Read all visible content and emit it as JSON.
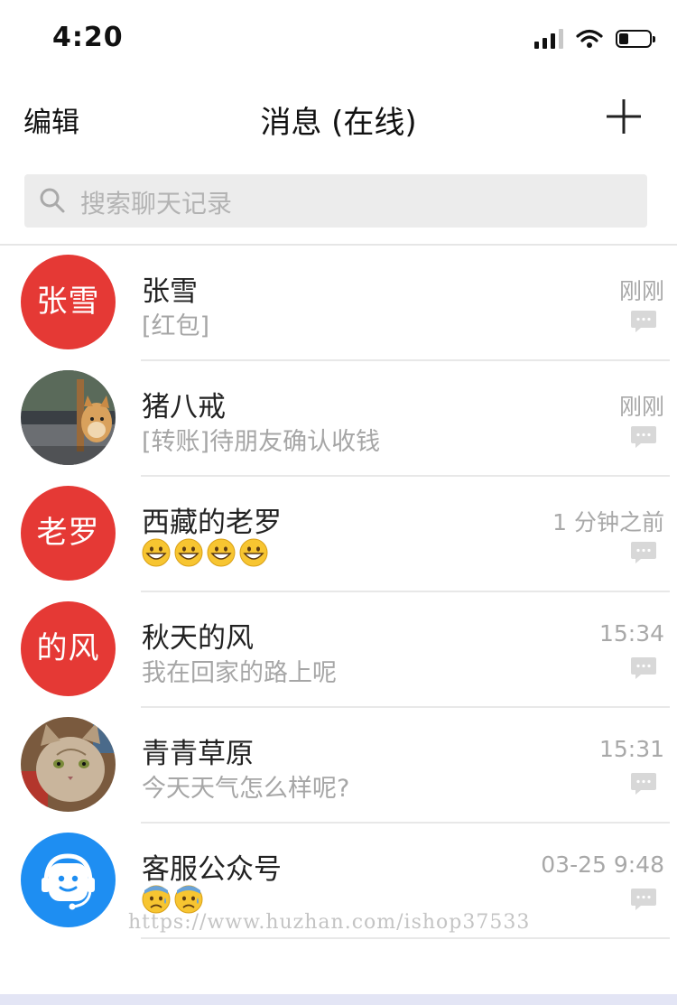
{
  "status_bar": {
    "time": "4:20"
  },
  "nav": {
    "edit_label": "编辑",
    "title": "消息 (在线)"
  },
  "search": {
    "placeholder": "搜索聊天记录"
  },
  "conversations": [
    {
      "name": "张雪",
      "message": "[红包]",
      "time": "刚刚",
      "avatar_text": "张雪",
      "avatar_type": "text-red"
    },
    {
      "name": "猪八戒",
      "message": "[转账]待朋友确认收钱",
      "time": "刚刚",
      "avatar_type": "photo-dog"
    },
    {
      "name": "西藏的老罗",
      "message": "",
      "emoji_count": 4,
      "emoji": "grinning-face",
      "time": "1 分钟之前",
      "avatar_text": "老罗",
      "avatar_type": "text-red"
    },
    {
      "name": "秋天的风",
      "message": "我在回家的路上呢",
      "time": "15:34",
      "avatar_text": "的风",
      "avatar_type": "text-red"
    },
    {
      "name": "青青草原",
      "message": "今天天气怎么样呢?",
      "time": "15:31",
      "avatar_type": "photo-cat"
    },
    {
      "name": "客服公众号",
      "message": "",
      "emoji_count": 2,
      "emoji": "anxious-sweat-face",
      "time": "03-25 9:48",
      "avatar_type": "service-blue"
    }
  ],
  "watermark": "https://www.huzhan.com/ishop37533",
  "colors": {
    "avatar_red": "#e53935",
    "avatar_blue": "#1e8ef2",
    "muted_text": "#a6a6a6",
    "search_bg": "#ececec"
  }
}
